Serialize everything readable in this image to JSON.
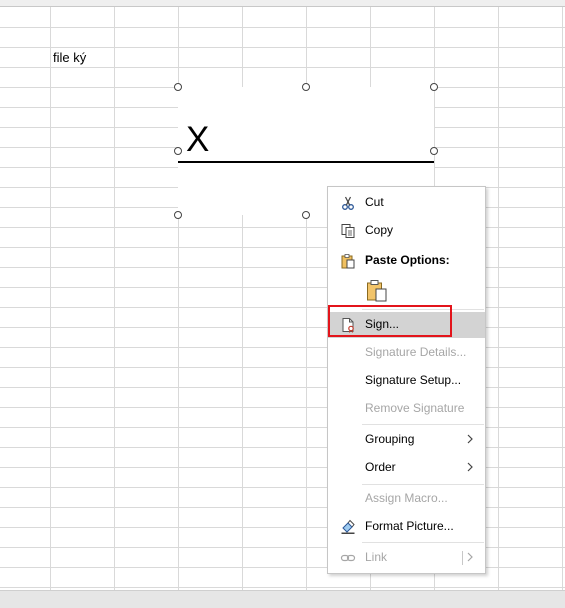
{
  "sheet": {
    "cell_text": "file ký"
  },
  "signature": {
    "mark": "X"
  },
  "context_menu": {
    "items": [
      {
        "label": "Cut",
        "shortcut_letter": "t"
      },
      {
        "label": "Copy"
      },
      {
        "label": "Paste Options:"
      },
      {
        "label": "Sign..."
      },
      {
        "label": "Signature Details..."
      },
      {
        "label": "Signature Setup..."
      },
      {
        "label": "Remove Signature"
      },
      {
        "label": "Grouping"
      },
      {
        "label": "Order"
      },
      {
        "label": "Assign Macro..."
      },
      {
        "label": "Format Picture..."
      },
      {
        "label": "Link"
      }
    ]
  },
  "colors": {
    "highlight": "#d3d3d3",
    "annotation_red": "#e3141b",
    "disabled_text": "#a6a6a6"
  }
}
